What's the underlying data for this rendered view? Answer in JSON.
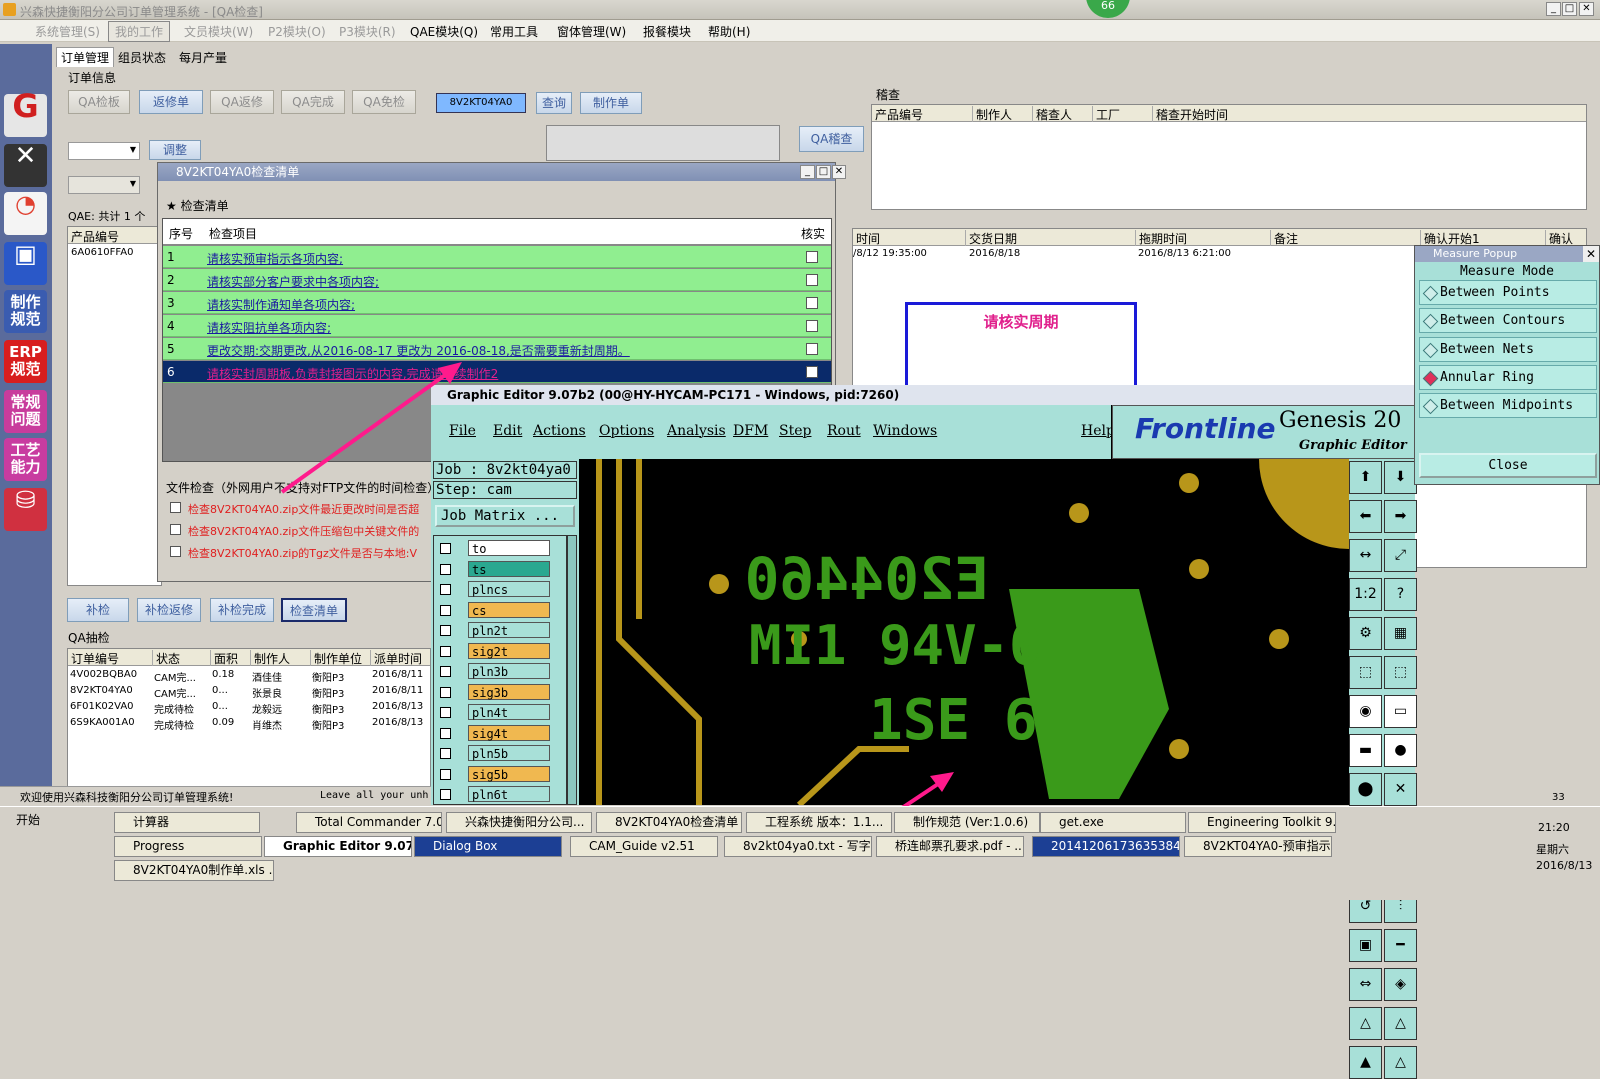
{
  "app": {
    "title": "兴森快捷衡阳分公司订单管理系统 - [QA检查]",
    "counter": "66"
  },
  "menu": [
    "系统管理(S)",
    "我的工作",
    "文员模块(W)",
    "P2模块(O)",
    "P3模块(R)",
    "QAE模块(Q)",
    "常用工具",
    "窗体管理(W)",
    "报餐模块",
    "帮助(H)"
  ],
  "tabs": [
    "订单管理",
    "组员状态",
    "每月产量"
  ],
  "order_info": {
    "label": "订单信息",
    "buttons": [
      "QA检板",
      "返修单",
      "QA返修",
      "QA完成",
      "QA免检"
    ],
    "job_field": "8V2KT04YA0",
    "query": "查询",
    "make_doc": "制作单",
    "adjust": "调整",
    "qa_audit": "QA稽查"
  },
  "sidebar": [
    "制作规范",
    "ERP规范",
    "常规问题",
    "工艺能力"
  ],
  "audit": {
    "label": "稽查",
    "cols": [
      "产品编号",
      "制作人",
      "稽查人",
      "工厂",
      "稽查开始时间"
    ]
  },
  "qae": {
    "summary": "QAE: 共计 1 个",
    "col": "产品编号",
    "value": "6A0610FFA0"
  },
  "mid_grid": {
    "cols": [
      "时间",
      "交货日期",
      "拖期时间",
      "备注",
      "确认开始1",
      "确认"
    ],
    "row": [
      "/8/12 19:35:00",
      "2016/8/18",
      "2016/8/13 6:21:00"
    ]
  },
  "note_box": "请核实周期",
  "checklist": {
    "title": "8V2KT04YA0检查清单",
    "section": "检查清单",
    "col_no": "序号",
    "col_item": "检查项目",
    "col_check": "核实",
    "items": [
      {
        "n": "1",
        "t": "请核实预审指示各项内容;"
      },
      {
        "n": "2",
        "t": "请核实部分客户要求中各项内容;"
      },
      {
        "n": "3",
        "t": "请核实制作通知单各项内容;"
      },
      {
        "n": "4",
        "t": "请核实阻抗单各项内容;"
      },
      {
        "n": "5",
        "t": "更改交期:交期更改,从2016-08-17 更改为 2016-08-18,是否需要重新封周期。"
      },
      {
        "n": "6",
        "t": "请核实封周期板,负责封接图示的内容,完成请继续制作2"
      }
    ],
    "file_check": "文件检查（外网用户不支持对FTP文件的时间检查）",
    "file_items": [
      "检查8V2KT04YA0.zip文件最近更改时间是否超",
      "检查8V2KT04YA0.zip文件压缩包中关键文件的",
      "检查8V2KT04YA0.zip的Tgz文件是否与本地:V"
    ]
  },
  "bottom_buttons": [
    "补检",
    "补检返修",
    "补检完成",
    "检查清单"
  ],
  "qa_sample": {
    "label": "QA抽检",
    "cols": [
      "订单编号",
      "状态",
      "面积",
      "制作人",
      "制作单位",
      "派单时间"
    ],
    "rows": [
      [
        "4V002BQBA0",
        "CAM完...",
        "0.18",
        "酒佳佳",
        "衡阳P3",
        "2016/8/11"
      ],
      [
        "8V2KT04YA0",
        "CAM完...",
        "0...",
        "张景良",
        "衡阳P3",
        "2016/8/11"
      ],
      [
        "6F01K02VA0",
        "完成待检",
        "0...",
        "龙毅远",
        "衡阳P3",
        "2016/8/13"
      ],
      [
        "6S9KA001A0",
        "完成待检",
        "0.09",
        "肖维杰",
        "衡阳P3",
        "2016/8/13"
      ]
    ]
  },
  "status": {
    "welcome": "欢迎使用兴森科技衡阳分公司订单管理系统!",
    "leave": "Leave all your unh",
    "num": "33"
  },
  "genesis": {
    "title": "Graphic Editor 9.07b2 (00@HY-HYCAM-PC171 - Windows, pid:7260)",
    "menu": [
      "File",
      "Edit",
      "Actions",
      "Options",
      "Analysis",
      "DFM",
      "Step",
      "Rout",
      "Windows",
      "Help"
    ],
    "brand": "Frontline",
    "product": "Genesis 20",
    "sub": "Graphic Editor",
    "job": "Job : 8v2kt04ya0",
    "step": "Step: cam",
    "matrix": "Job Matrix ...",
    "layers": [
      {
        "n": "to",
        "c": "#ffffff"
      },
      {
        "n": "ts",
        "c": "#2aa890"
      },
      {
        "n": "plncs",
        "c": "#a8e0d8"
      },
      {
        "n": "cs",
        "c": "#f0b850"
      },
      {
        "n": "pln2t",
        "c": "#a8e0d8"
      },
      {
        "n": "sig2t",
        "c": "#f0b850"
      },
      {
        "n": "pln3b",
        "c": "#a8e0d8"
      },
      {
        "n": "sig3b",
        "c": "#f0b850"
      },
      {
        "n": "pln4t",
        "c": "#a8e0d8"
      },
      {
        "n": "sig4t",
        "c": "#f0b850"
      },
      {
        "n": "pln5b",
        "c": "#a8e0d8"
      },
      {
        "n": "sig5b",
        "c": "#f0b850"
      },
      {
        "n": "pln6t",
        "c": "#a8e0d8"
      }
    ],
    "pcb_text": [
      "E204460",
      "MI1 94V-0",
      "1SE 6"
    ]
  },
  "measure": {
    "title": "Measure Popup",
    "mode": "Measure Mode",
    "options": [
      "Between Points",
      "Between Contours",
      "Between Nets",
      "Annular Ring",
      "Between Midpoints"
    ],
    "selected": 3,
    "close": "Close"
  },
  "taskbar": {
    "start": "开始",
    "row1": [
      "计算器",
      "Total Commander 7.0 ...",
      "兴森快捷衡阳分公司...",
      "8V2KT04YA0检查清单",
      "工程系统  版本：1.1...",
      "制作规范 (Ver:1.0.6)",
      "get.exe",
      "Engineering Toolkit 9.0..."
    ],
    "row2": [
      "Progress",
      "Graphic Editor 9.07b...",
      "Dialog Box",
      "CAM_Guide v2.51",
      "8v2kt04ya0.txt - 写字板",
      "桥连邮票孔要求.pdf - ...",
      "20141206173635384.rt...",
      "8V2KT04YA0-预审指示..."
    ],
    "row3": [
      "8V2KT04YA0制作单.xls ..."
    ],
    "time": "21:20",
    "weekday": "星期六",
    "date": "2016/8/13"
  }
}
